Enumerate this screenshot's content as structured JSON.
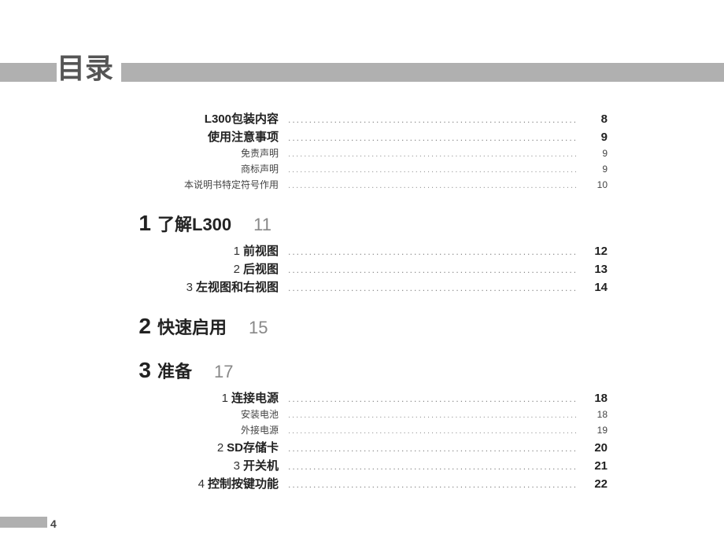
{
  "title": "目录",
  "footer_page": "4",
  "pre_items": [
    {
      "label": "L300包装内容",
      "page": "8",
      "type": "main"
    },
    {
      "label": "使用注意事项",
      "page": "9",
      "type": "main"
    },
    {
      "label": "免责声明",
      "page": "9",
      "type": "sub"
    },
    {
      "label": "商标声明",
      "page": "9",
      "type": "sub"
    },
    {
      "label": "本说明书特定符号作用",
      "page": "10",
      "type": "sub"
    }
  ],
  "chapters": [
    {
      "num": "1",
      "title": "了解L300",
      "page": "11",
      "items": [
        {
          "idx": "1",
          "label": "前视图",
          "page": "12",
          "type": "main"
        },
        {
          "idx": "2",
          "label": "后视图",
          "page": "13",
          "type": "main"
        },
        {
          "idx": "3",
          "label": "左视图和右视图",
          "page": "14",
          "type": "main"
        }
      ]
    },
    {
      "num": "2",
      "title": "快速启用",
      "page": "15",
      "items": []
    },
    {
      "num": "3",
      "title": "准备",
      "page": "17",
      "items": [
        {
          "idx": "1",
          "label": "连接电源",
          "page": "18",
          "type": "main"
        },
        {
          "idx": "",
          "label": "安装电池",
          "page": "18",
          "type": "sub"
        },
        {
          "idx": "",
          "label": "外接电源",
          "page": "19",
          "type": "sub"
        },
        {
          "idx": "2",
          "label": "SD存储卡",
          "page": "20",
          "type": "main"
        },
        {
          "idx": "3",
          "label": "开关机",
          "page": "21",
          "type": "main"
        },
        {
          "idx": "4",
          "label": "控制按键功能",
          "page": "22",
          "type": "main"
        }
      ]
    }
  ]
}
